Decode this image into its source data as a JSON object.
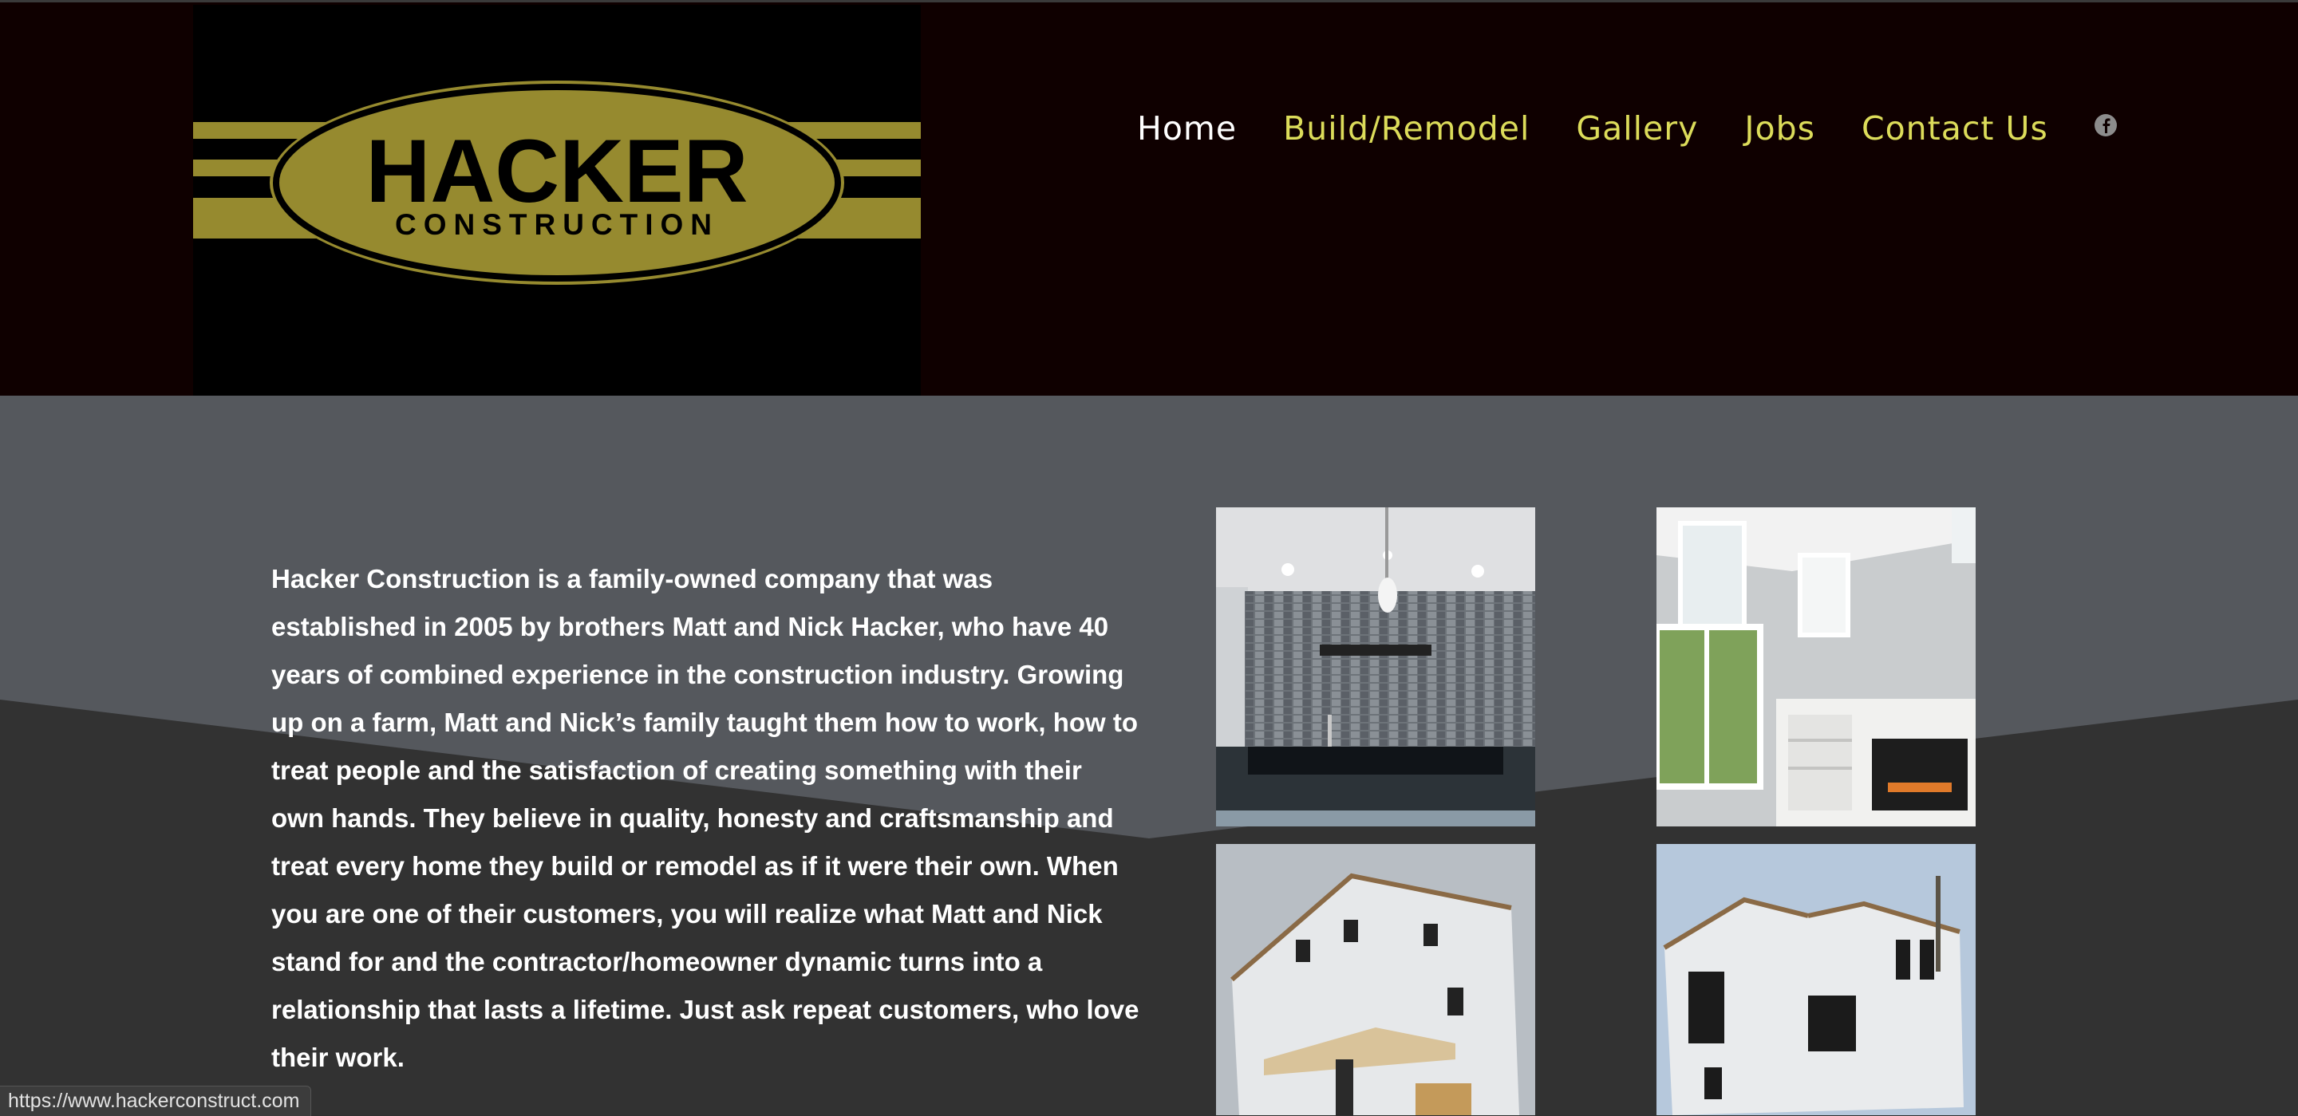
{
  "logo": {
    "line1": "HACKER",
    "line2": "CONSTRUCTION",
    "gold": "#968a2f"
  },
  "nav": {
    "items": [
      {
        "label": "Home",
        "active": true
      },
      {
        "label": "Build/Remodel",
        "active": false
      },
      {
        "label": "Gallery",
        "active": false
      },
      {
        "label": "Jobs",
        "active": false
      },
      {
        "label": "Contact Us",
        "active": false
      }
    ],
    "social_icon": "facebook-icon",
    "active_color": "#ffffff",
    "link_color": "#dcdc5a"
  },
  "about": {
    "text": "Hacker Construction is a family-owned company that was established in 2005 by brothers Matt and Nick Hacker, who have 40 years of combined experience in the construction industry. Growing up on a farm, Matt and Nick’s family taught them how to work, how to treat people and the satisfaction of creating something with their own hands. They believe in quality, honesty and craftsmanship and treat every home they build or remodel as if it were their own. When you are one of their customers, you will realize what Matt and Nick stand for and the contractor/homeowner dynamic turns into a relationship that lasts a lifetime. Just ask repeat customers, who love their work."
  },
  "gallery": {
    "photos": [
      {
        "subject": "kitchen-backsplash"
      },
      {
        "subject": "living-room-fireplace"
      },
      {
        "subject": "house-under-construction-front"
      },
      {
        "subject": "house-under-construction-side"
      }
    ]
  },
  "statusbar": {
    "url": "https://www.hackerconstruct.com"
  },
  "colors": {
    "header_bg": "#0f0000",
    "content_bg": "#55585d",
    "content_dark": "#323232"
  }
}
